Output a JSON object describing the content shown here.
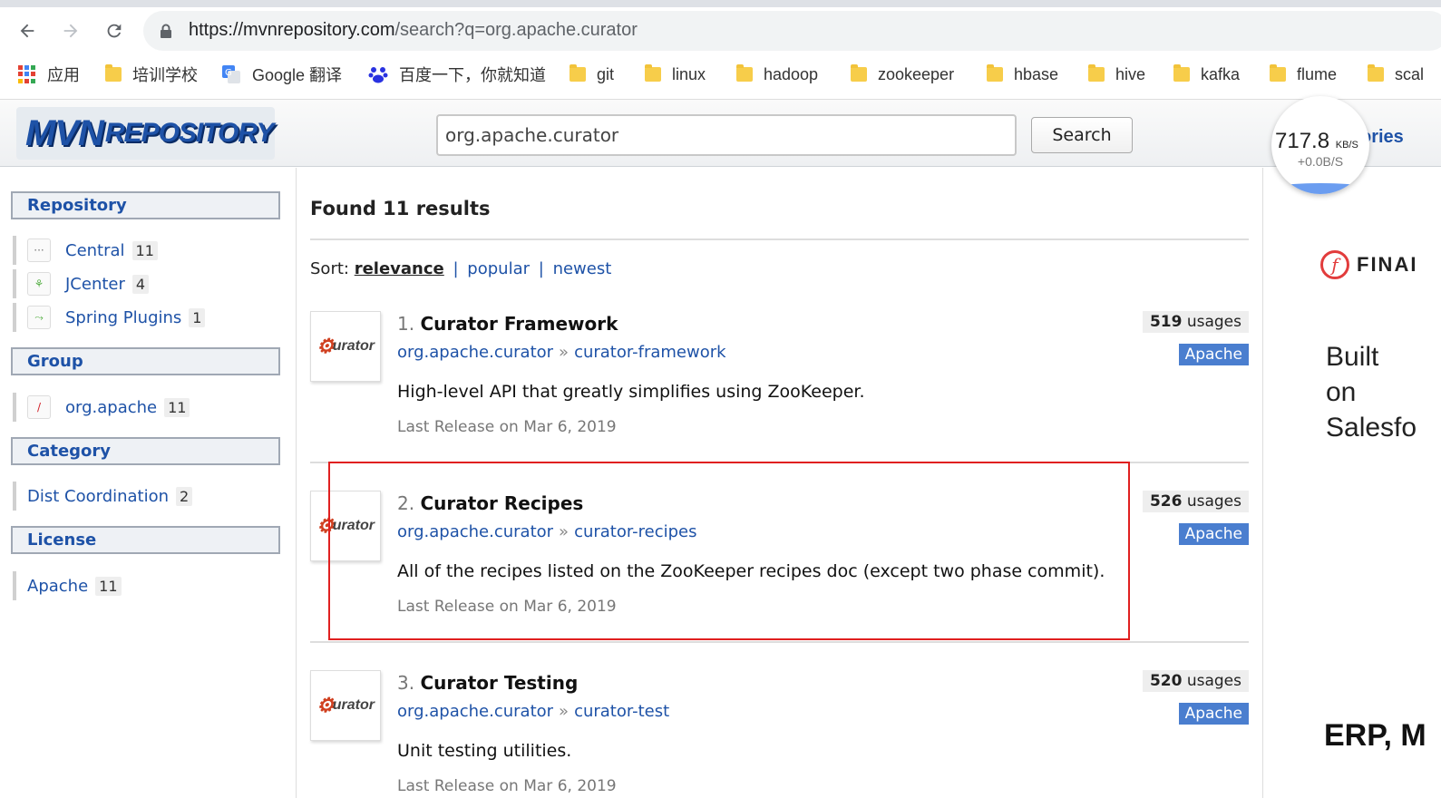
{
  "browser": {
    "url_host": "https://mvnrepository.com",
    "url_path": "/search?q=org.apache.curator",
    "bookmarks": [
      {
        "label": "应用",
        "icon": "apps-grid-icon"
      },
      {
        "label": "培训学校",
        "icon": "folder-icon"
      },
      {
        "label": "Google 翻译",
        "icon": "google-translate-icon"
      },
      {
        "label": "百度一下，你就知道",
        "icon": "baidu-icon"
      },
      {
        "label": "git",
        "icon": "folder-icon"
      },
      {
        "label": "linux",
        "icon": "folder-icon"
      },
      {
        "label": "hadoop",
        "icon": "folder-icon"
      },
      {
        "label": "zookeeper",
        "icon": "folder-icon"
      },
      {
        "label": "hbase",
        "icon": "folder-icon"
      },
      {
        "label": "hive",
        "icon": "folder-icon"
      },
      {
        "label": "kafka",
        "icon": "folder-icon"
      },
      {
        "label": "flume",
        "icon": "folder-icon"
      },
      {
        "label": "scal",
        "icon": "folder-icon"
      }
    ]
  },
  "header": {
    "logo_main": "MVN",
    "logo_sub": "REPOSITORY",
    "search_value": "org.apache.curator",
    "search_button": "Search",
    "categories_link": "ories"
  },
  "speed": {
    "value": "717.8",
    "unit": "KB/S",
    "sub": "+0.0B/S"
  },
  "sidebar": {
    "repository": {
      "title": "Repository",
      "items": [
        {
          "label": "Central",
          "count": "11",
          "icon": "central-icon"
        },
        {
          "label": "JCenter",
          "count": "4",
          "icon": "jcenter-icon"
        },
        {
          "label": "Spring Plugins",
          "count": "1",
          "icon": "spring-icon"
        }
      ]
    },
    "group": {
      "title": "Group",
      "items": [
        {
          "label": "org.apache",
          "count": "11",
          "icon": "apache-feather-icon"
        }
      ]
    },
    "category": {
      "title": "Category",
      "items": [
        {
          "label": "Dist Coordination",
          "count": "2"
        }
      ]
    },
    "license": {
      "title": "License",
      "items": [
        {
          "label": "Apache",
          "count": "11"
        }
      ]
    }
  },
  "main": {
    "results_title": "Found 11 results",
    "sort_label": "Sort:",
    "sort_options": [
      "relevance",
      "popular",
      "newest"
    ],
    "results": [
      {
        "num": "1.",
        "name": "Curator Framework",
        "group": "org.apache.curator",
        "artifact": "curator-framework",
        "description": "High-level API that greatly simplifies using ZooKeeper.",
        "date": "Last Release on Mar 6, 2019",
        "usages_count": "519",
        "usages_label": "usages",
        "license": "Apache",
        "logo_text": "urator"
      },
      {
        "num": "2.",
        "name": "Curator Recipes",
        "group": "org.apache.curator",
        "artifact": "curator-recipes",
        "description": "All of the recipes listed on the ZooKeeper recipes doc (except two phase commit).",
        "date": "Last Release on Mar 6, 2019",
        "usages_count": "526",
        "usages_label": "usages",
        "license": "Apache",
        "logo_text": "urator"
      },
      {
        "num": "3.",
        "name": "Curator Testing",
        "group": "org.apache.curator",
        "artifact": "curator-test",
        "description": "Unit testing utilities.",
        "date": "Last Release on Mar 6, 2019",
        "usages_count": "520",
        "usages_label": "usages",
        "license": "Apache",
        "logo_text": "urator"
      }
    ]
  },
  "ad": {
    "brand": "FINAI",
    "text_lines": [
      "Built",
      "on",
      "Salesfo"
    ],
    "bottom": "ERP, M"
  }
}
